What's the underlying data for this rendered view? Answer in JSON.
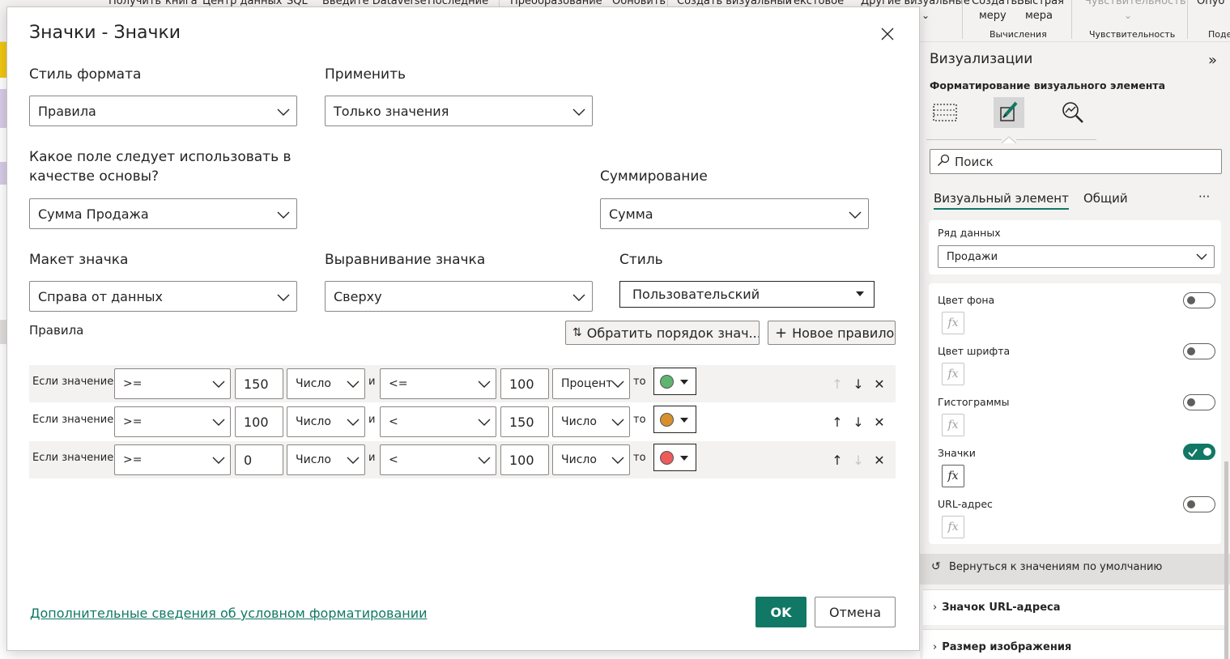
{
  "ribbon": {
    "items": [
      "Получить",
      "книга",
      "Центр данных",
      "SQL",
      "Введите Dataverse",
      "Последние",
      "Преобразование",
      "Обновить",
      "Создать визуальный",
      "Текстовое",
      "Другие визуальные",
      "Создать",
      "Быстрая",
      "Чувствительность",
      "Опуб"
    ],
    "row2": [
      "меру",
      "мера"
    ],
    "groups": [
      "Вычисления",
      "Чувствительность",
      "Поде"
    ]
  },
  "dialog": {
    "title": "Значки - Значки",
    "format_style_label": "Стиль формата",
    "format_style_value": "Правила",
    "apply_label": "Применить",
    "apply_value": "Только значения",
    "base_field_label_line1": "Какое поле следует использовать в",
    "base_field_label_line2": "качестве основы?",
    "base_field_value": "Сумма Продажа",
    "summarization_label": "Суммирование",
    "summarization_value": "Сумма",
    "icon_layout_label": "Макет значка",
    "icon_layout_value": "Справа от данных",
    "icon_alignment_label": "Выравнивание значка",
    "icon_alignment_value": "Сверху",
    "style_label": "Стиль",
    "style_value": "Пользовательский",
    "rules_label": "Правила",
    "reverse_button": "Обратить порядок знач...",
    "new_rule_button": "Новое правило",
    "rules": [
      {
        "if": "Если значение",
        "op1": ">=",
        "val1": "150",
        "type1": "Число",
        "and": "и",
        "op2": "<=",
        "val2": "100",
        "type2": "Процент",
        "then": "то",
        "color": "#5fb46f"
      },
      {
        "if": "Если значение",
        "op1": ">=",
        "val1": "100",
        "type1": "Число",
        "and": "и",
        "op2": "<",
        "val2": "150",
        "type2": "Число",
        "then": "то",
        "color": "#d8902c"
      },
      {
        "if": "Если значение",
        "op1": ">=",
        "val1": "0",
        "type1": "Число",
        "and": "и",
        "op2": "<",
        "val2": "100",
        "type2": "Число",
        "then": "то",
        "color": "#ee5b5b"
      }
    ],
    "learn_more_link": "Дополнительные сведения об условном форматировании",
    "ok_button": "OK",
    "cancel_button": "Отмена"
  },
  "viz_panel": {
    "title": "Визуализации",
    "subtitle": "Форматирование визуального элемента",
    "search_placeholder": "Поиск",
    "tab_visual": "Визуальный элемент",
    "tab_general": "Общий",
    "more": "···",
    "series_label": "Ряд данных",
    "series_value": "Продажи",
    "toggles": [
      {
        "label": "Цвет фона",
        "on": false
      },
      {
        "label": "Цвет шрифта",
        "on": false
      },
      {
        "label": "Гистограммы",
        "on": false
      },
      {
        "label": "Значки",
        "on": true
      },
      {
        "label": "URL-адрес",
        "on": false
      }
    ],
    "fx": "fx",
    "reset_label": "Вернуться к значениям по умолчанию",
    "section_url_icon": "Значок URL-адреса",
    "section_image_size": "Размер изображения"
  },
  "colors": {
    "accent": "#117865"
  }
}
